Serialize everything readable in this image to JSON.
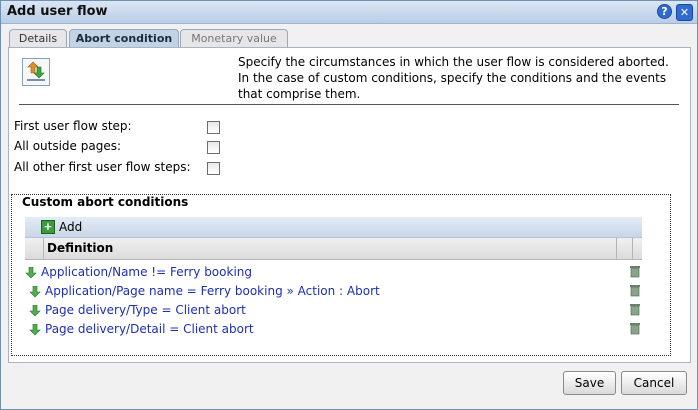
{
  "dialog": {
    "title": "Add user flow",
    "help_icon": "help-icon",
    "close_icon": "close-icon"
  },
  "tabs": [
    {
      "label": "Details",
      "active": false
    },
    {
      "label": "Abort condition",
      "active": true
    },
    {
      "label": "Monetary value",
      "active": false
    }
  ],
  "header": {
    "icon": "abort-flow-icon",
    "description": "Specify the circumstances in which the user flow is considered aborted. In the case of custom conditions, specify the conditions and the events that comprise them."
  },
  "options": [
    {
      "label": "First user flow step:",
      "checked": false
    },
    {
      "label": "All outside pages:",
      "checked": false
    },
    {
      "label": "All other first user flow steps:",
      "checked": false
    }
  ],
  "custom": {
    "legend": "Custom abort conditions",
    "add_label": "Add",
    "column_header": "Definition",
    "conditions": [
      "Application/Name != Ferry booking",
      "Application/Page name = Ferry booking » Action : Abort",
      "Page delivery/Type = Client abort",
      "Page delivery/Detail = Client abort"
    ]
  },
  "buttons": {
    "save": "Save",
    "cancel": "Cancel"
  },
  "colors": {
    "accent": "#c2d3e7",
    "link": "#1d2fb3",
    "titlebar": "#b9cde6"
  }
}
